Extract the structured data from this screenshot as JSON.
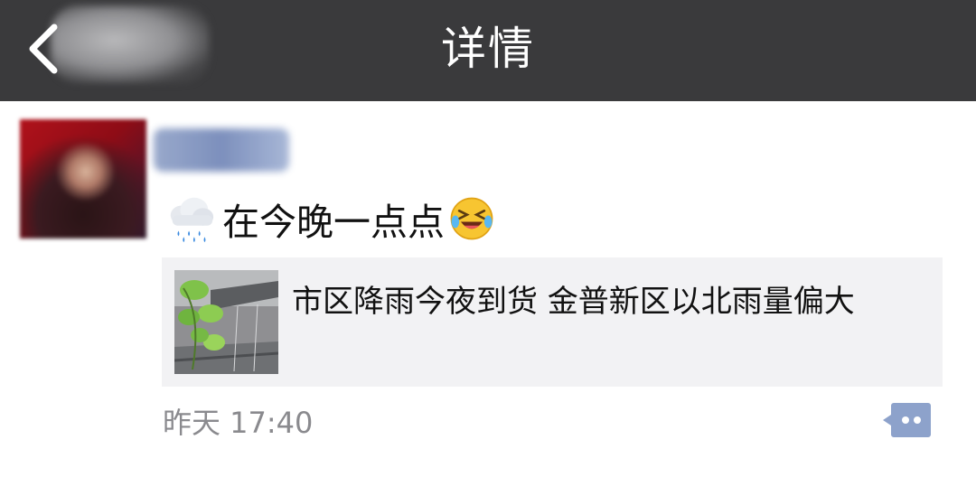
{
  "navbar": {
    "title": "详情",
    "back_icon": "chevron-left-icon",
    "background": "#3a3a3c"
  },
  "post": {
    "text": "在今晚一点点",
    "leading_emoji": "rain-cloud-emoji",
    "trailing_emoji": "laughing-tears-emoji",
    "link": {
      "title": "市区降雨今夜到货 金普新区以北雨量偏大",
      "thumbnail": "leaves-in-rain-image"
    },
    "timestamp": "昨天 17:40",
    "comment_icon": "comment-bubble-icon"
  },
  "colors": {
    "link_card_bg": "#f2f2f4",
    "timestamp": "#8a8a8e",
    "comment_icon": "#8da2cb"
  }
}
